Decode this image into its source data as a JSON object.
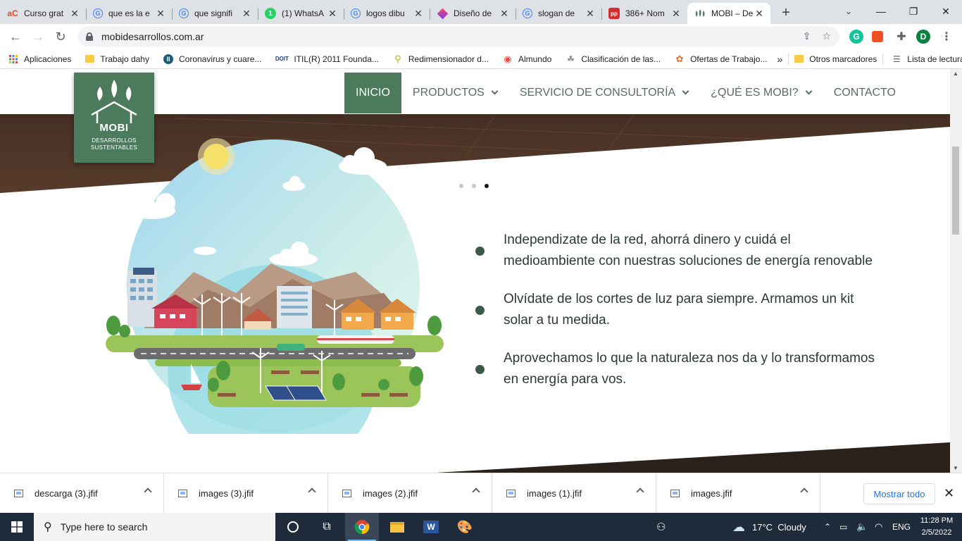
{
  "browser": {
    "tabs": [
      {
        "title": "Curso grat",
        "favicon": "aC",
        "active": false
      },
      {
        "title": "que es la e",
        "favicon": "G",
        "active": false
      },
      {
        "title": "que signifi",
        "favicon": "G",
        "active": false
      },
      {
        "title": "(1) WhatsA",
        "favicon": "1",
        "active": false
      },
      {
        "title": "logos dibu",
        "favicon": "G",
        "active": false
      },
      {
        "title": "Diseño de",
        "favicon": "canva-diamond",
        "active": false
      },
      {
        "title": "slogan de",
        "favicon": "G",
        "active": false
      },
      {
        "title": "386+ Nom",
        "favicon": "pp",
        "active": false
      },
      {
        "title": "MOBI – De",
        "favicon": "mobi-leaves",
        "active": true
      }
    ],
    "address": "mobidesarrollos.com.ar",
    "profile_initial": "D",
    "bookmarks": [
      {
        "label": "Aplicaciones",
        "icon": "apps-grid-icon"
      },
      {
        "label": "Trabajo dahy",
        "icon": "folder-icon"
      },
      {
        "label": "Coronavirus y cuare...",
        "icon": "site-icon"
      },
      {
        "label": "ITIL(R) 2011 Founda...",
        "icon": "site-icon"
      },
      {
        "label": "Redimensionador d...",
        "icon": "site-icon"
      },
      {
        "label": "Almundo",
        "icon": "site-icon"
      },
      {
        "label": "Clasificación de las...",
        "icon": "site-icon"
      },
      {
        "label": "Ofertas de Trabajo...",
        "icon": "site-icon"
      }
    ],
    "bookmarks_overflow": "»",
    "other_bookmarks": "Otros marcadores",
    "reading_list": "Lista de lectura"
  },
  "site": {
    "logo": {
      "brand": "MOBI",
      "tagline_1": "DESARROLLOS",
      "tagline_2": "SUSTENTABLES"
    },
    "nav": [
      {
        "label": "INICIO",
        "active": true,
        "dropdown": false
      },
      {
        "label": "PRODUCTOS",
        "active": false,
        "dropdown": true
      },
      {
        "label": "SERVICIO DE CONSULTORÍA",
        "active": false,
        "dropdown": true
      },
      {
        "label": "¿QUÉ ES MOBI?",
        "active": false,
        "dropdown": true
      },
      {
        "label": "CONTACTO",
        "active": false,
        "dropdown": false
      }
    ],
    "slider": {
      "count": 3,
      "active_index": 2
    },
    "bullets": [
      "Independizate de la red, ahorrá dinero y cuidá el medioambiente con nuestras soluciones de energía renovable",
      "Olvídate de los cortes de luz para siempre. Armamos un kit solar a tu medida.",
      "Aprovechamos lo que la naturaleza nos da y lo transformamos en energía para vos."
    ],
    "colors": {
      "brand_green": "#4b7a5c",
      "bullet_dot": "#3b5a48"
    }
  },
  "downloads": {
    "items": [
      "descarga (3).jfif",
      "images (3).jfif",
      "images (2).jfif",
      "images (1).jfif",
      "images.jfif"
    ],
    "show_all": "Mostrar todo"
  },
  "taskbar": {
    "search_placeholder": "Type here to search",
    "weather": "17°C  Cloudy",
    "language": "ENG",
    "time": "11:28 PM",
    "date": "2/5/2022"
  }
}
